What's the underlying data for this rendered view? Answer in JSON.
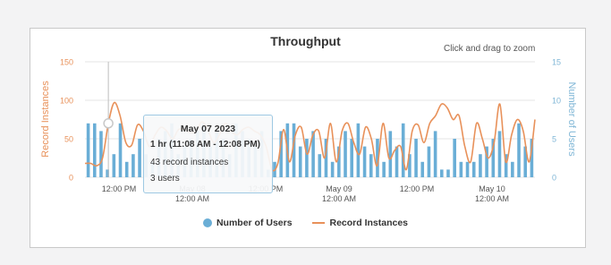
{
  "colors": {
    "bars": "#6aaed6",
    "line": "#e8915a",
    "left_axis": "#e8915a",
    "right_axis": "#7fb6d6",
    "grid": "#e6e6e6",
    "text": "#555555"
  },
  "zoom_hint": "Click and drag to zoom",
  "chart_data": {
    "type": "bar+line",
    "title": "Throughput",
    "left_axis": {
      "label": "Record Instances",
      "range": [
        0,
        150
      ],
      "ticks": [
        "0",
        "50",
        "100",
        "150"
      ]
    },
    "right_axis": {
      "label": "Number of Users",
      "range": [
        0,
        15
      ],
      "ticks": [
        "0",
        "5",
        "10",
        "15"
      ]
    },
    "x_axis": {
      "ticks": [
        {
          "lines": [
            "12:00 PM"
          ]
        },
        {
          "lines": [
            "May 08",
            "12:00 AM"
          ]
        },
        {
          "lines": [
            "12:00 PM"
          ]
        },
        {
          "lines": [
            "May 09",
            "12:00 AM"
          ]
        },
        {
          "lines": [
            "12:00 PM"
          ]
        },
        {
          "lines": [
            "May 10",
            "12:00 AM"
          ]
        }
      ]
    },
    "series": [
      {
        "name": "Number of Users",
        "type": "bar",
        "values": [
          7,
          7,
          6,
          1,
          3,
          7,
          2,
          3,
          5,
          3,
          2,
          5,
          6,
          7,
          3,
          4,
          5,
          6,
          7,
          4,
          6,
          5,
          3,
          7,
          6,
          5,
          4,
          6,
          1,
          2,
          6,
          7,
          7,
          4,
          5,
          6,
          3,
          5,
          2,
          4,
          6,
          5,
          7,
          4,
          3,
          5,
          2,
          6,
          4,
          7,
          3,
          5,
          2,
          4,
          6,
          1,
          1,
          5,
          2,
          2,
          2,
          3,
          4,
          5,
          6,
          3,
          2,
          7,
          4,
          5
        ]
      },
      {
        "name": "Record Instances",
        "type": "line",
        "values": [
          18,
          18,
          15,
          25,
          70,
          97,
          80,
          45,
          42,
          68,
          60,
          40,
          55,
          65,
          60,
          50,
          62,
          62,
          58,
          60,
          72,
          62,
          45,
          55,
          70,
          60,
          55,
          62,
          65,
          60,
          55,
          40,
          10,
          18,
          62,
          20,
          55,
          65,
          30,
          55,
          60,
          25,
          70,
          20,
          60,
          70,
          45,
          30,
          65,
          50,
          15,
          70,
          25,
          35,
          40,
          10,
          60,
          68,
          45,
          70,
          80,
          95,
          90,
          75,
          80,
          40,
          20,
          70,
          50,
          25,
          45,
          95,
          20,
          55,
          75,
          60,
          20,
          75
        ]
      }
    ],
    "legend": {
      "position": "bottom-center",
      "entries": [
        "Number of Users",
        "Record Instances"
      ]
    },
    "crosshair_index": 4,
    "tooltip": {
      "date": "May 07 2023",
      "range": "1 hr (11:08 AM - 12:08 PM)",
      "record_instances": "43 record instances",
      "users": "3 users"
    }
  }
}
